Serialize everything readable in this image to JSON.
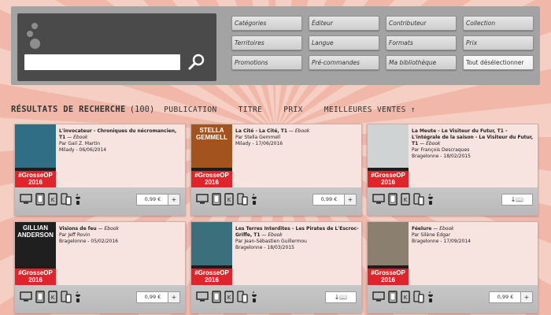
{
  "search": {
    "placeholder": ""
  },
  "filters": [
    {
      "label": "Catégories"
    },
    {
      "label": "Éditeur"
    },
    {
      "label": "Contributeur"
    },
    {
      "label": "Collection"
    },
    {
      "label": "Territoires"
    },
    {
      "label": "Langue"
    },
    {
      "label": "Formats"
    },
    {
      "label": "Prix"
    },
    {
      "label": "Promotions"
    },
    {
      "label": "Pré-commandes"
    },
    {
      "label": "Ma bibliothèque"
    },
    {
      "label": "Tout désélectionner"
    }
  ],
  "results": {
    "title": "RÉSULTATS DE RECHERCHE",
    "count": "(100)",
    "sort": [
      {
        "label": "PUBLICATION"
      },
      {
        "label": "TITRE"
      },
      {
        "label": "PRIX"
      },
      {
        "label": "MEILLEURES VENTES ↑"
      }
    ]
  },
  "badge": {
    "tag": "#GrosseOP",
    "year": "2016"
  },
  "books": [
    {
      "title": "L'invocateur - Chroniques du nécromancien, T1",
      "format": "Ebook",
      "author": "Par Gail Z. Martin",
      "publisher": "Milady - 06/06/2014",
      "price": "0,99 €",
      "action": "price",
      "cover_color": "#2f6e84"
    },
    {
      "title": "La Cité - La Cité, T1",
      "format": "Ebook",
      "author": "Par Stella Gemmell",
      "publisher": "Milady - 17/06/2016",
      "price": "0,99 €",
      "action": "price",
      "cover_color": "#a3541e",
      "cover_text": "STELLA GEMMELL"
    },
    {
      "title": "La Meute - Le Visiteur du Futur, T1 - L'intégrale de la saison - Le Visiteur du Futur, T1",
      "format": "Ebook",
      "author": "Par François Descraques",
      "publisher": "Bragelonne - 18/02/2015",
      "price": "",
      "action": "download",
      "cover_color": "#cfd3d3"
    },
    {
      "title": "Visions de feu",
      "format": "Ebook",
      "author": "Par Jeff Rovin",
      "publisher": "Bragelonne - 05/02/2016",
      "price": "0,99 €",
      "action": "price",
      "cover_color": "#1f1f1f",
      "cover_text": "GILLIAN ANDERSON"
    },
    {
      "title": "Les Terres Interdites - Les Pirates de L'Escroc-Griffe, T1",
      "format": "Ebook",
      "author": "Par Jean-Sébastien Guillermou",
      "publisher": "Bragelonne - 18/03/2015",
      "price": "",
      "action": "download",
      "cover_color": "#3b6f7c"
    },
    {
      "title": "Féelure",
      "format": "Ebook",
      "author": "Par Silène Edgar",
      "publisher": "Bragelonne - 17/09/2014",
      "price": "0,99 €",
      "action": "price",
      "cover_color": "#8b8070"
    }
  ],
  "labels": {
    "download": "↓📖",
    "add": "+",
    "dash": "—"
  },
  "icons": {
    "search": "search-icon",
    "devices": [
      "desktop-icon",
      "tablet-icon",
      "kindle-icon",
      "phone-tablet-icon",
      "apple-android-icon"
    ]
  }
}
